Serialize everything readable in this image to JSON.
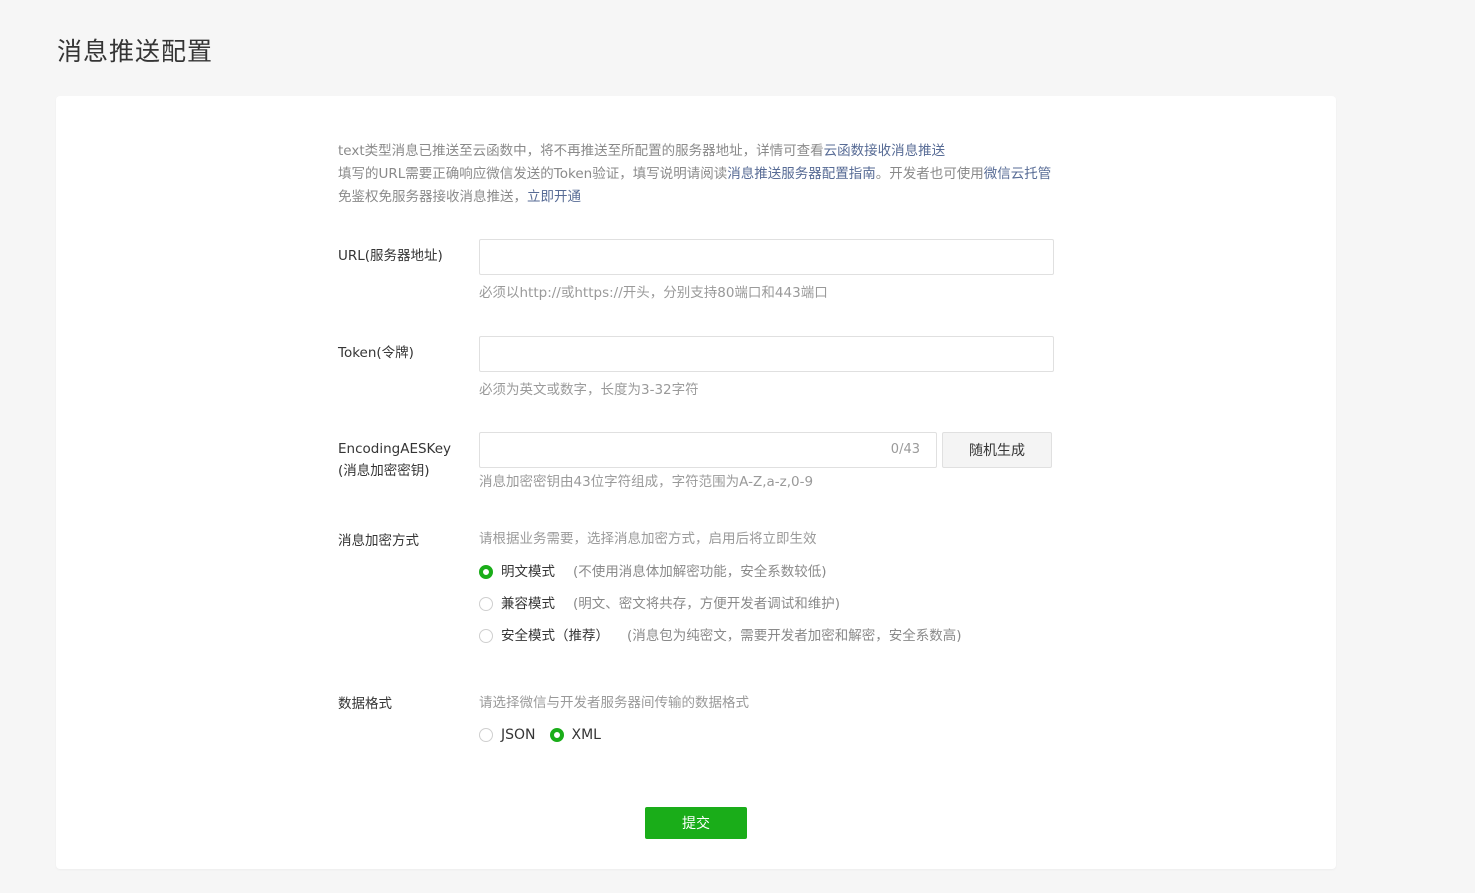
{
  "page": {
    "title": "消息推送配置"
  },
  "notice": {
    "line1_text": "text类型消息已推送至云函数中，将不再推送至所配置的服务器地址，详情可查看",
    "line1_link": "云函数接收消息推送",
    "line2_text": "填写的URL需要正确响应微信发送的Token验证，填写说明请阅读",
    "line2_link": "消息推送服务器配置指南",
    "line2_mid": "。开发者也可使用",
    "line2_link2": "微信云托管",
    "line2_tail": "免鉴权免服务器接收消息推送，",
    "line2_link3": "立即开通"
  },
  "form": {
    "url": {
      "label": "URL(服务器地址)",
      "value": "",
      "hint": "必须以http://或https://开头，分别支持80端口和443端口"
    },
    "token": {
      "label": "Token(令牌)",
      "value": "",
      "hint": "必须为英文或数字，长度为3-32字符"
    },
    "aes_key": {
      "label_line1": "EncodingAESKey",
      "label_line2": "(消息加密密钥)",
      "value": "",
      "counter": "0/43",
      "generate_label": "随机生成",
      "hint": "消息加密密钥由43位字符组成，字符范围为A-Z,a-z,0-9"
    },
    "encrypt_mode": {
      "label": "消息加密方式",
      "hint": "请根据业务需要，选择消息加密方式，启用后将立即生效",
      "options": [
        {
          "label": "明文模式",
          "desc": "(不使用消息体加解密功能，安全系数较低)",
          "checked": true
        },
        {
          "label": "兼容模式",
          "desc": "(明文、密文将共存，方便开发者调试和维护)",
          "checked": false
        },
        {
          "label": "安全模式（推荐）",
          "desc": "(消息包为纯密文，需要开发者加密和解密，安全系数高)",
          "checked": false
        }
      ]
    },
    "data_format": {
      "label": "数据格式",
      "hint": "请选择微信与开发者服务器间传输的数据格式",
      "options": [
        {
          "label": "JSON",
          "checked": false
        },
        {
          "label": "XML",
          "checked": true
        }
      ]
    },
    "submit_label": "提交"
  },
  "colors": {
    "accent_green": "#1aad19",
    "link_blue": "#576b95",
    "page_bg": "#f6f6f6"
  }
}
